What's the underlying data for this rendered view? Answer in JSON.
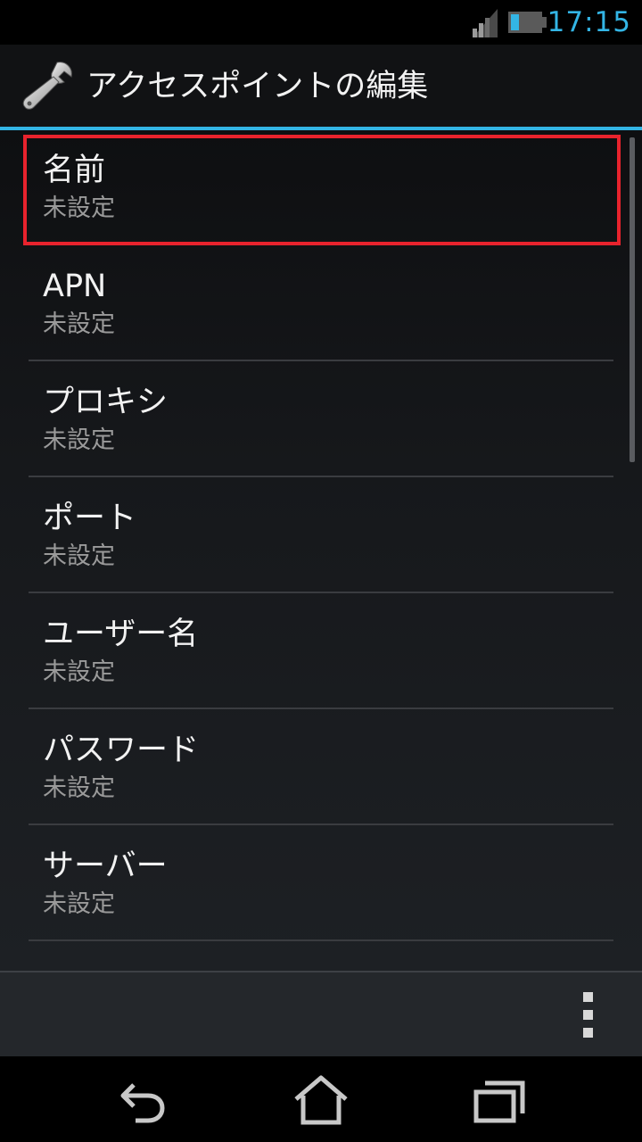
{
  "status_bar": {
    "time": "17:15",
    "icons": [
      "signal-icon",
      "battery-icon"
    ],
    "accent_color": "#33b5e5"
  },
  "action_bar": {
    "icon": "wrench-icon",
    "title": "アクセスポイントの編集"
  },
  "preferences": [
    {
      "title": "名前",
      "summary": "未設定",
      "highlighted": true
    },
    {
      "title": "APN",
      "summary": "未設定"
    },
    {
      "title": "プロキシ",
      "summary": "未設定"
    },
    {
      "title": "ポート",
      "summary": "未設定"
    },
    {
      "title": "ユーザー名",
      "summary": "未設定"
    },
    {
      "title": "パスワード",
      "summary": "未設定"
    },
    {
      "title": "サーバー",
      "summary": "未設定"
    }
  ],
  "highlight_color": "#e8232d",
  "bottom_bar": {
    "overflow_icon": "overflow-menu-icon"
  },
  "nav_bar": {
    "buttons": [
      "back-icon",
      "home-icon",
      "recent-apps-icon"
    ]
  }
}
